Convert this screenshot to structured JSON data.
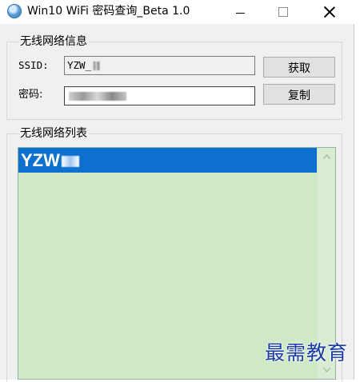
{
  "window": {
    "title": "Win10 WiFi 密码查询_Beta 1.0",
    "icon": "wifi-globe-icon",
    "controls": [
      "minimize",
      "maximize",
      "close"
    ]
  },
  "info_group": {
    "legend": "无线网络信息",
    "ssid_label": "SSID:",
    "ssid_value": "YZW_",
    "password_label": "密码:",
    "password_value": "",
    "fetch_button": "获取",
    "copy_button": "复制"
  },
  "list_group": {
    "legend": "无线网络列表",
    "items": [
      {
        "label": "YZW",
        "selected": true
      }
    ]
  },
  "colors": {
    "list_background": "#cfe8c6",
    "selection": "#0d6fce",
    "watermark": "#1a3aa8"
  },
  "watermark": "最需教育"
}
